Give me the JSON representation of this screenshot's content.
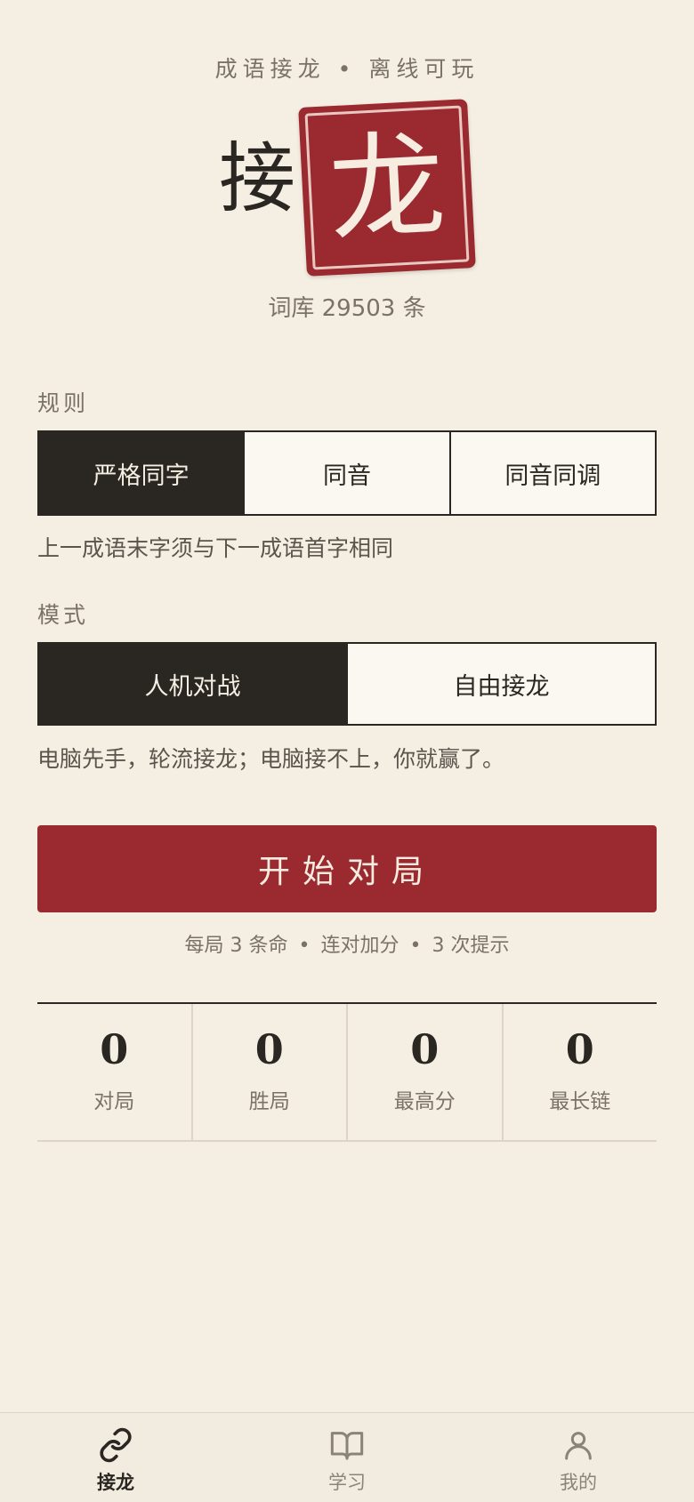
{
  "header": {
    "tagline_left": "成语接龙",
    "tagline_dot": "•",
    "tagline_right": "离线可玩",
    "title_char": "接",
    "seal_char": "龙",
    "dict_count": "词库 29503 条"
  },
  "rules": {
    "label": "规则",
    "options": [
      "严格同字",
      "同音",
      "同音同调"
    ],
    "selected_index": 0,
    "description": "上一成语末字须与下一成语首字相同"
  },
  "mode": {
    "label": "模式",
    "options": [
      "人机对战",
      "自由接龙"
    ],
    "selected_index": 0,
    "description": "电脑先手，轮流接龙；电脑接不上，你就赢了。"
  },
  "start": {
    "label": "开始对局",
    "hints": [
      "每局 3 条命",
      "连对加分",
      "3 次提示"
    ],
    "separator": "•"
  },
  "stats": [
    {
      "value": "0",
      "label": "对局"
    },
    {
      "value": "0",
      "label": "胜局"
    },
    {
      "value": "0",
      "label": "最高分"
    },
    {
      "value": "0",
      "label": "最长链"
    }
  ],
  "tabbar": {
    "tabs": [
      {
        "label": "接龙",
        "icon": "link-icon",
        "active": true
      },
      {
        "label": "学习",
        "icon": "book-icon",
        "active": false
      },
      {
        "label": "我的",
        "icon": "user-icon",
        "active": false
      }
    ]
  },
  "colors": {
    "background": "#f5efe3",
    "accent_red": "#9a2a30",
    "ink": "#2a2622",
    "muted": "#7a7268"
  }
}
